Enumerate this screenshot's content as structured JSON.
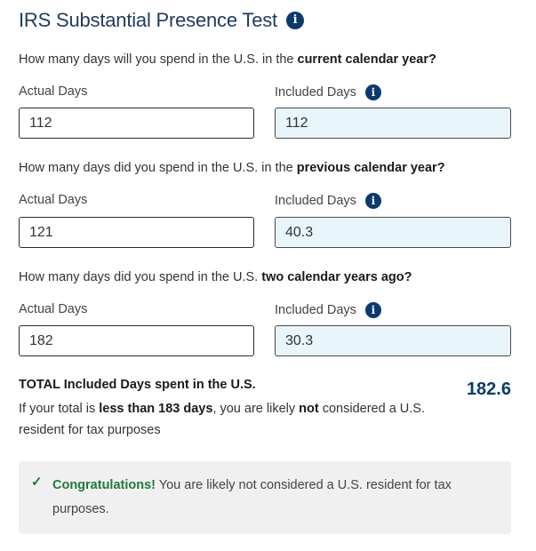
{
  "title": "IRS Substantial Presence Test",
  "questions": [
    {
      "prefix": "How many days will you spend in the U.S. in the ",
      "emphasis": "current calendar year?",
      "actual_label": "Actual Days",
      "included_label": "Included Days",
      "actual_value": "112",
      "included_value": "112"
    },
    {
      "prefix": "How many days did you spend in the U.S. in the ",
      "emphasis": "previous calendar year?",
      "actual_label": "Actual Days",
      "included_label": "Included Days",
      "actual_value": "121",
      "included_value": "40.3"
    },
    {
      "prefix": "How many days did you spend in the U.S. ",
      "emphasis": "two calendar years ago?",
      "actual_label": "Actual Days",
      "included_label": "Included Days",
      "actual_value": "182",
      "included_value": "30.3"
    }
  ],
  "total": {
    "label": "TOTAL Included Days spent in the U.S.",
    "value": "182.6",
    "note_pre": "If your total is ",
    "note_bold1": "less than 183 days",
    "note_mid": ", you are likely ",
    "note_bold2": "not",
    "note_post": " considered a U.S. resident for tax purposes"
  },
  "result": {
    "congrats": "Congratulations!",
    "message": " You are likely not considered a U.S. resident for tax purposes."
  },
  "icons": {
    "info": "info-icon",
    "check": "check-icon"
  },
  "colors": {
    "title": "#1f3a5f",
    "info_icon": "#0b3a6e",
    "included_bg": "#e8f5fb",
    "success": "#1f7a3a",
    "result_bg": "#f0f0f0"
  }
}
